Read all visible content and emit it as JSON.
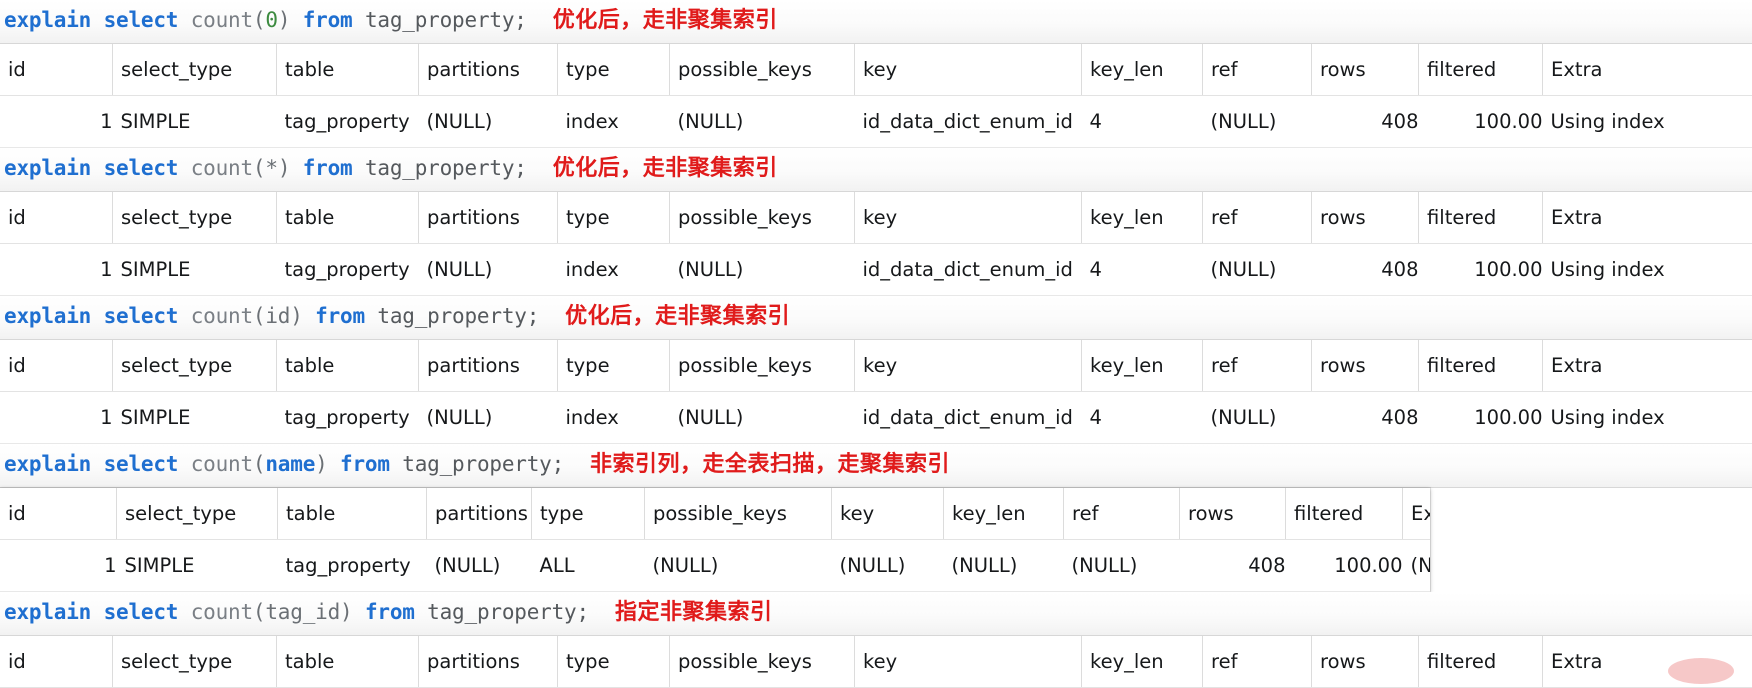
{
  "columns": [
    "id",
    "select_type",
    "table",
    "partitions",
    "type",
    "possible_keys",
    "key",
    "key_len",
    "ref",
    "rows",
    "filtered",
    "Extra"
  ],
  "blocks": [
    {
      "sql": {
        "kw1": "explain",
        "kw2": "select",
        "fn": "count",
        "open": "(",
        "arg": "0",
        "close": ")",
        "kw3": "from",
        "ident": "tag_property;",
        "note": "优化后，走非聚集索引"
      },
      "table": {
        "style": "full",
        "headers": [
          "id",
          "select_type",
          "table",
          "partitions",
          "type",
          "possible_keys",
          "key",
          "key_len",
          "ref",
          "rows",
          "filtered",
          "Extra"
        ],
        "rows": [
          {
            "id": "1",
            "select_type": "SIMPLE",
            "table": "tag_property",
            "partitions": "(NULL)",
            "type": "index",
            "possible_keys": "(NULL)",
            "key": "id_data_dict_enum_id",
            "key_len": "4",
            "ref": "(NULL)",
            "rows": "408",
            "filtered": "100.00",
            "extra": "Using index"
          }
        ]
      }
    },
    {
      "sql": {
        "kw1": "explain",
        "kw2": "select",
        "fn": "count",
        "open": "(",
        "arg": "*",
        "close": ")",
        "kw3": "from",
        "ident": "tag_property;",
        "note": "优化后，走非聚集索引"
      },
      "table": {
        "style": "full",
        "headers": [
          "id",
          "select_type",
          "table",
          "partitions",
          "type",
          "possible_keys",
          "key",
          "key_len",
          "ref",
          "rows",
          "filtered",
          "Extra"
        ],
        "rows": [
          {
            "id": "1",
            "select_type": "SIMPLE",
            "table": "tag_property",
            "partitions": "(NULL)",
            "type": "index",
            "possible_keys": "(NULL)",
            "key": "id_data_dict_enum_id",
            "key_len": "4",
            "ref": "(NULL)",
            "rows": "408",
            "filtered": "100.00",
            "extra": "Using index"
          }
        ]
      }
    },
    {
      "sql": {
        "kw1": "explain",
        "kw2": "select",
        "fn": "count",
        "open": "(",
        "arg": "id",
        "close": ")",
        "kw3": "from",
        "ident": "tag_property;",
        "note": "优化后，走非聚集索引"
      },
      "table": {
        "style": "full",
        "headers": [
          "id",
          "select_type",
          "table",
          "partitions",
          "type",
          "possible_keys",
          "key",
          "key_len",
          "ref",
          "rows",
          "filtered",
          "Extra"
        ],
        "rows": [
          {
            "id": "1",
            "select_type": "SIMPLE",
            "table": "tag_property",
            "partitions": "(NULL)",
            "type": "index",
            "possible_keys": "(NULL)",
            "key": "id_data_dict_enum_id",
            "key_len": "4",
            "ref": "(NULL)",
            "rows": "408",
            "filtered": "100.00",
            "extra": "Using index"
          }
        ]
      }
    },
    {
      "sql": {
        "kw1": "explain",
        "kw2": "select",
        "fn": "count",
        "open": "(",
        "arg": "name",
        "close": ")",
        "kw3": "from",
        "ident": "tag_property;",
        "note": "非索引列，走全表扫描，走聚集索引"
      },
      "table": {
        "style": "boxed",
        "headers": [
          "id",
          "select_type",
          "table",
          "partitions",
          "type",
          "possible_keys",
          "key",
          "key_len",
          "ref",
          "rows",
          "filtered",
          "Extra"
        ],
        "rows": [
          {
            "id": "1",
            "select_type": "SIMPLE",
            "table": "tag_property",
            "partitions": "(NULL)",
            "type": "ALL",
            "possible_keys": "(NULL)",
            "key": "(NULL)",
            "key_len": "(NULL)",
            "ref": "(NULL)",
            "rows": "408",
            "filtered": "100.00",
            "extra": "(NULL)"
          }
        ]
      }
    },
    {
      "sql": {
        "kw1": "explain",
        "kw2": "select",
        "fn": "count",
        "open": "(",
        "arg": "tag_id",
        "close": ")",
        "kw3": "from",
        "ident": "tag_property;",
        "note": "指定非聚集索引"
      },
      "table": {
        "style": "full",
        "headers": [
          "id",
          "select_type",
          "table",
          "partitions",
          "type",
          "possible_keys",
          "key",
          "key_len",
          "ref",
          "rows",
          "filtered",
          "Extra"
        ],
        "rows": []
      }
    }
  ],
  "colors": {
    "keyword": "#1f6fd0",
    "note": "#e01b1b",
    "null": "#b2b2b2",
    "text": "#16181a"
  }
}
